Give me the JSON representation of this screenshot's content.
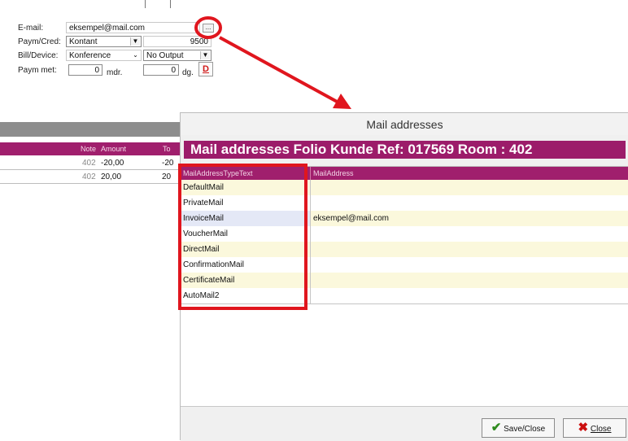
{
  "form": {
    "email_label": "E-mail:",
    "email_value": "eksempel@mail.com",
    "more_button": "...",
    "paym_cred_label": "Paym/Cred:",
    "paym_cred_value": "Kontant",
    "paym_cred_number": "9500",
    "bill_device_label": "Bill/Device:",
    "bill_device_value": "Konference",
    "output_value": "No Output",
    "paym_met_label": "Paym met:",
    "paym_met_months_value": "0",
    "paym_met_months_unit": "mdr.",
    "paym_met_days_value": "0",
    "paym_met_days_unit": "dg.",
    "d_button": "D"
  },
  "background_table": {
    "headers": [
      "Note",
      "Amount",
      "To"
    ],
    "rows": [
      {
        "note": "402",
        "amount": "-20,00",
        "total": "-20"
      },
      {
        "note": "402",
        "amount": "20,00",
        "total": "20"
      }
    ]
  },
  "dialog": {
    "title": "Mail addresses",
    "banner": "Mail addresses Folio Kunde Ref: 017569 Room : 402",
    "columns": [
      "MailAddressTypeText",
      "MailAddress"
    ],
    "rows": [
      {
        "type": "DefaultMail",
        "address": ""
      },
      {
        "type": "PrivateMail",
        "address": ""
      },
      {
        "type": "InvoiceMail",
        "address": "eksempel@mail.com"
      },
      {
        "type": "VoucherMail",
        "address": ""
      },
      {
        "type": "DirectMail",
        "address": ""
      },
      {
        "type": "ConfirmationMail",
        "address": ""
      },
      {
        "type": "CertificateMail",
        "address": ""
      },
      {
        "type": "AutoMail2",
        "address": ""
      }
    ],
    "save_close_label": "Save/Close",
    "close_label": "Close"
  },
  "colors": {
    "accent": "#9c1c6a",
    "annotation": "#e0161e",
    "row_highlight": "#fbf8dc",
    "selected_row": "#e4e8f6",
    "save_check": "#2e8b1e",
    "close_x": "#cc1010"
  }
}
